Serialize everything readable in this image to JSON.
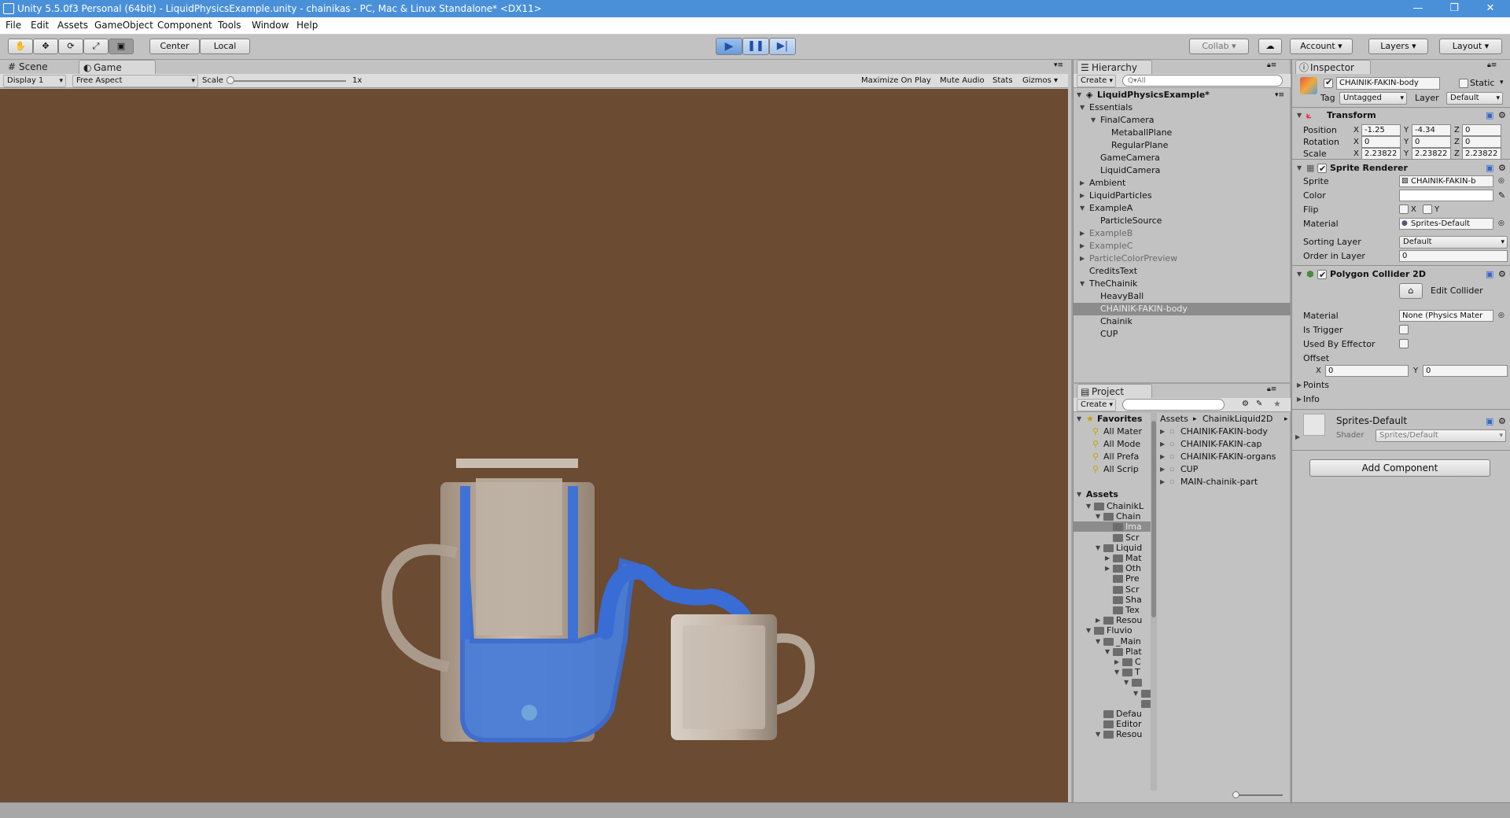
{
  "window": {
    "title": "Unity 5.5.0f3 Personal (64bit) - LiquidPhysicsExample.unity - chainikas - PC, Mac & Linux Standalone* <DX11>",
    "minimize": "—",
    "maximize": "❐",
    "close": "✕"
  },
  "menu": [
    "File",
    "Edit",
    "Assets",
    "GameObject",
    "Component",
    "Tools",
    "Window",
    "Help"
  ],
  "toolbar": {
    "center": "Center",
    "local": "Local",
    "collab": "Collab",
    "account": "Account",
    "layers": "Layers",
    "layout": "Layout"
  },
  "game_view": {
    "tab_scene": "Scene",
    "tab_game": "Game",
    "display": "Display 1",
    "aspect": "Free Aspect",
    "scale_label": "Scale",
    "scale_value": "1x",
    "maximize_on_play": "Maximize On Play",
    "mute_audio": "Mute Audio",
    "stats": "Stats",
    "gizmos": "Gizmos",
    "background_color": "#6b4b31",
    "liquid_color": "#4a7ed8"
  },
  "hierarchy": {
    "tab": "Hierarchy",
    "create": "Create",
    "search_placeholder": "Q▾All",
    "scene": "LiquidPhysicsExample*",
    "items": [
      {
        "label": "Essentials",
        "indent": 1,
        "arrow": "down"
      },
      {
        "label": "FinalCamera",
        "indent": 2,
        "arrow": "down"
      },
      {
        "label": "MetaballPlane",
        "indent": 3,
        "arrow": ""
      },
      {
        "label": "RegularPlane",
        "indent": 3,
        "arrow": ""
      },
      {
        "label": "GameCamera",
        "indent": 2,
        "arrow": ""
      },
      {
        "label": "LiquidCamera",
        "indent": 2,
        "arrow": ""
      },
      {
        "label": "Ambient",
        "indent": 1,
        "arrow": "right"
      },
      {
        "label": "LiquidParticles",
        "indent": 1,
        "arrow": "right"
      },
      {
        "label": "ExampleA",
        "indent": 1,
        "arrow": "down"
      },
      {
        "label": "ParticleSource",
        "indent": 2,
        "arrow": ""
      },
      {
        "label": "ExampleB",
        "indent": 1,
        "arrow": "right",
        "gray": true
      },
      {
        "label": "ExampleC",
        "indent": 1,
        "arrow": "right",
        "gray": true
      },
      {
        "label": "ParticleColorPreview",
        "indent": 1,
        "arrow": "right",
        "gray": true
      },
      {
        "label": "CreditsText",
        "indent": 1,
        "arrow": ""
      },
      {
        "label": "TheChainik",
        "indent": 1,
        "arrow": "down"
      },
      {
        "label": "HeavyBall",
        "indent": 2,
        "arrow": ""
      },
      {
        "label": "CHAINIK-FAKIN-body",
        "indent": 2,
        "arrow": "",
        "selected": true
      },
      {
        "label": "Chainik",
        "indent": 2,
        "arrow": ""
      },
      {
        "label": "CUP",
        "indent": 2,
        "arrow": ""
      }
    ]
  },
  "project": {
    "tab": "Project",
    "create": "Create",
    "favorites": "Favorites",
    "fav_items": [
      "All Mater",
      "All Mode",
      "All Prefa",
      "All Scrip"
    ],
    "assets": "Assets",
    "tree": [
      {
        "label": "ChainikL",
        "indent": 1,
        "arrow": "down"
      },
      {
        "label": "Chain",
        "indent": 2,
        "arrow": "down"
      },
      {
        "label": "Ima",
        "indent": 3,
        "arrow": "",
        "selected": true
      },
      {
        "label": "Scr",
        "indent": 3,
        "arrow": ""
      },
      {
        "label": "Liquid",
        "indent": 2,
        "arrow": "down"
      },
      {
        "label": "Mat",
        "indent": 3,
        "arrow": "right"
      },
      {
        "label": "Oth",
        "indent": 3,
        "arrow": "right"
      },
      {
        "label": "Pre",
        "indent": 3,
        "arrow": ""
      },
      {
        "label": "Scr",
        "indent": 3,
        "arrow": ""
      },
      {
        "label": "Sha",
        "indent": 3,
        "arrow": ""
      },
      {
        "label": "Tex",
        "indent": 3,
        "arrow": ""
      },
      {
        "label": "Resou",
        "indent": 2,
        "arrow": "right"
      },
      {
        "label": "Fluvio",
        "indent": 1,
        "arrow": "down"
      },
      {
        "label": "_Main",
        "indent": 2,
        "arrow": "down"
      },
      {
        "label": "Plat",
        "indent": 3,
        "arrow": "down"
      },
      {
        "label": "C",
        "indent": 4,
        "arrow": "right"
      },
      {
        "label": "T",
        "indent": 4,
        "arrow": "down"
      },
      {
        "label": "",
        "indent": 5,
        "arrow": "down"
      },
      {
        "label": "",
        "indent": 6,
        "arrow": "down"
      },
      {
        "label": "",
        "indent": 6,
        "arrow": ""
      },
      {
        "label": "Defau",
        "indent": 2,
        "arrow": ""
      },
      {
        "label": "Editor",
        "indent": 2,
        "arrow": ""
      },
      {
        "label": "Resou",
        "indent": 2,
        "arrow": "down"
      }
    ],
    "breadcrumb": [
      "Assets",
      "ChainikLiquid2D"
    ],
    "files": [
      "CHAINIK-FAKIN-body",
      "CHAINIK-FAKIN-cap",
      "CHAINIK-FAKIN-organs",
      "CUP",
      "MAIN-chainik-part"
    ]
  },
  "inspector": {
    "tab": "Inspector",
    "object_name": "CHAINIK-FAKIN-body",
    "static_label": "Static",
    "tag_label": "Tag",
    "tag_value": "Untagged",
    "layer_label": "Layer",
    "layer_value": "Default",
    "transform": {
      "title": "Transform",
      "position_label": "Position",
      "rotation_label": "Rotation",
      "scale_label": "Scale",
      "position": {
        "x": "-1.25",
        "y": "-4.34",
        "z": "0"
      },
      "rotation": {
        "x": "0",
        "y": "0",
        "z": "0"
      },
      "scale": {
        "x": "2.23822",
        "y": "2.23822",
        "z": "2.23822"
      }
    },
    "sprite_renderer": {
      "title": "Sprite Renderer",
      "sprite_label": "Sprite",
      "sprite_value": "CHAINIK-FAKIN-b",
      "color_label": "Color",
      "color_value": "#ffffff",
      "flip_label": "Flip",
      "flip_x": "X",
      "flip_y": "Y",
      "material_label": "Material",
      "material_value": "Sprites-Default",
      "sorting_layer_label": "Sorting Layer",
      "sorting_layer_value": "Default",
      "order_label": "Order in Layer",
      "order_value": "0"
    },
    "polygon_collider": {
      "title": "Polygon Collider 2D",
      "edit_collider": "Edit Collider",
      "material_label": "Material",
      "material_value": "None (Physics Mater",
      "is_trigger_label": "Is Trigger",
      "used_by_effector_label": "Used By Effector",
      "offset_label": "Offset",
      "offset_x_label": "X",
      "offset_x": "0",
      "offset_y_label": "Y",
      "offset_y": "0",
      "points_label": "Points",
      "info_label": "Info"
    },
    "material_preview": {
      "name": "Sprites-Default",
      "shader_label": "Shader",
      "shader_value": "Sprites/Default"
    },
    "add_component": "Add Component"
  }
}
